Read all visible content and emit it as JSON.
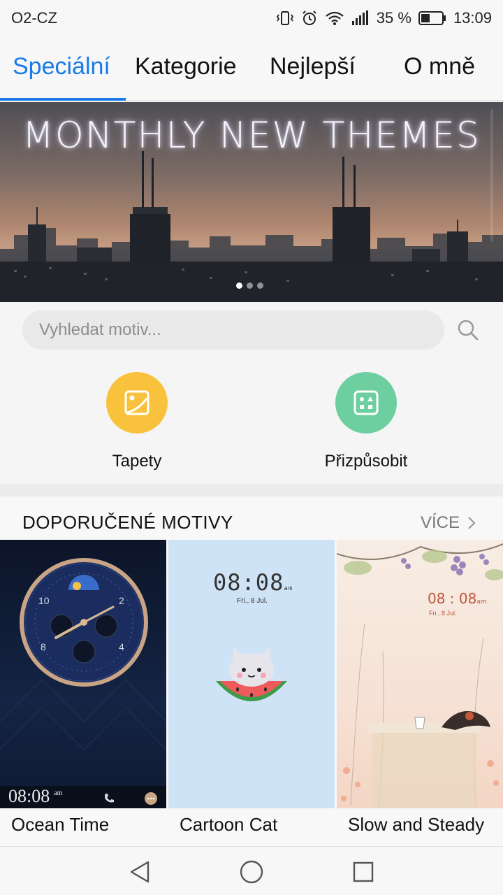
{
  "status": {
    "carrier": "O2-CZ",
    "battery": "35 %",
    "time": "13:09"
  },
  "tabs": [
    {
      "label": "Speciální",
      "active": true
    },
    {
      "label": "Kategorie",
      "active": false
    },
    {
      "label": "Nejlepší",
      "active": false
    },
    {
      "label": "O mně",
      "active": false
    }
  ],
  "banner": {
    "title": "MONTHLY NEW THEMES",
    "slides": 3,
    "current_slide": 1
  },
  "search": {
    "placeholder": "Vyhledat motiv..."
  },
  "quick_actions": [
    {
      "label": "Tapety",
      "icon": "image-icon",
      "color": "#f9c23c"
    },
    {
      "label": "Přizpůsobit",
      "icon": "customize-icon",
      "color": "#6dcfa0"
    }
  ],
  "recommended": {
    "title": "DOPORUČENÉ MOTIVY",
    "more_label": "VÍCE",
    "themes": [
      {
        "name": "Ocean Time",
        "clock": "08:08",
        "suffix": "am"
      },
      {
        "name": "Cartoon Cat",
        "clock": "08:08",
        "suffix": "am",
        "date": "Fri., 8 Jul."
      },
      {
        "name": "Slow and Steady",
        "clock": "08 : 08",
        "suffix": "am",
        "date": "Fri., 8 Jul."
      }
    ]
  },
  "colors": {
    "accent": "#1a7ae8"
  }
}
